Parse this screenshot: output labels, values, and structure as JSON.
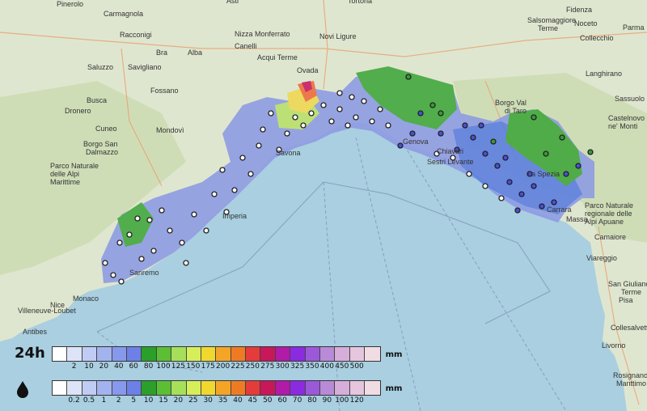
{
  "map": {
    "places": [
      "Pinerolo",
      "Asti",
      "Tortona",
      "Fidenza",
      "Parma",
      "Carmagnola",
      "Nizza Monferrato",
      "Novi Ligure",
      "Salsomaggiore Terme",
      "Noceto",
      "Racconigi",
      "Bra",
      "Alba",
      "Canelli",
      "Collecchio",
      "Saluzzo",
      "Savigliano",
      "Acqui Terme",
      "Ovada",
      "Langhirano",
      "Busca",
      "Fossano",
      "Borgo Val di Taro",
      "Dronero",
      "Cuneo",
      "Mondovì",
      "Castelnovo ne' Monti",
      "Borgo San Dalmazzo",
      "Parco Naturale delle Alpi Marittime",
      "Savona",
      "Genova",
      "Chiavari",
      "Sestri Levante",
      "La Spezia",
      "Carrara",
      "Massa",
      "Camaiore",
      "Viareggio",
      "San Giuliano Terme",
      "Pisa",
      "Livorno",
      "Collesalvetti",
      "Rosignano Marittimo",
      "Sanremo",
      "Imperia",
      "Monaco",
      "Nice",
      "Villeneuve-Loubet",
      "Antibes",
      "Parco Naturale regionale delle Alpi Apuane",
      "Sassuolo"
    ]
  },
  "legend_24h": {
    "label": "24h",
    "unit": "mm",
    "colors": [
      "#ffffff",
      "#dde4f7",
      "#c0ccf3",
      "#a3b3ef",
      "#8799ec",
      "#6d80e7",
      "#2aa02a",
      "#5bbf34",
      "#a6e05a",
      "#d6ee5a",
      "#f0d82f",
      "#f4a527",
      "#ee7b23",
      "#e63b3b",
      "#c8185a",
      "#b21aa8",
      "#8b2be0",
      "#9b59d9",
      "#b98ad8",
      "#d7add9",
      "#e5c6de",
      "#f0dde3"
    ],
    "ticks": [
      "2",
      "10",
      "20",
      "40",
      "60",
      "80",
      "100",
      "125",
      "150",
      "175",
      "200",
      "225",
      "250",
      "275",
      "300",
      "325",
      "350",
      "400",
      "450",
      "500"
    ]
  },
  "legend_rate": {
    "unit": "mm",
    "colors": [
      "#ffffff",
      "#dde4f7",
      "#c0ccf3",
      "#a3b3ef",
      "#8799ec",
      "#6d80e7",
      "#2aa02a",
      "#5bbf34",
      "#a6e05a",
      "#d6ee5a",
      "#f0d82f",
      "#f4a527",
      "#ee7b23",
      "#e63b3b",
      "#c8185a",
      "#b21aa8",
      "#8b2be0",
      "#9b59d9",
      "#b98ad8",
      "#d7add9",
      "#e5c6de",
      "#f0dde3"
    ],
    "ticks": [
      "0.2",
      "0.5",
      "1",
      "2",
      "5",
      "10",
      "15",
      "20",
      "25",
      "30",
      "35",
      "40",
      "45",
      "50",
      "60",
      "70",
      "80",
      "90",
      "100",
      "120"
    ]
  }
}
